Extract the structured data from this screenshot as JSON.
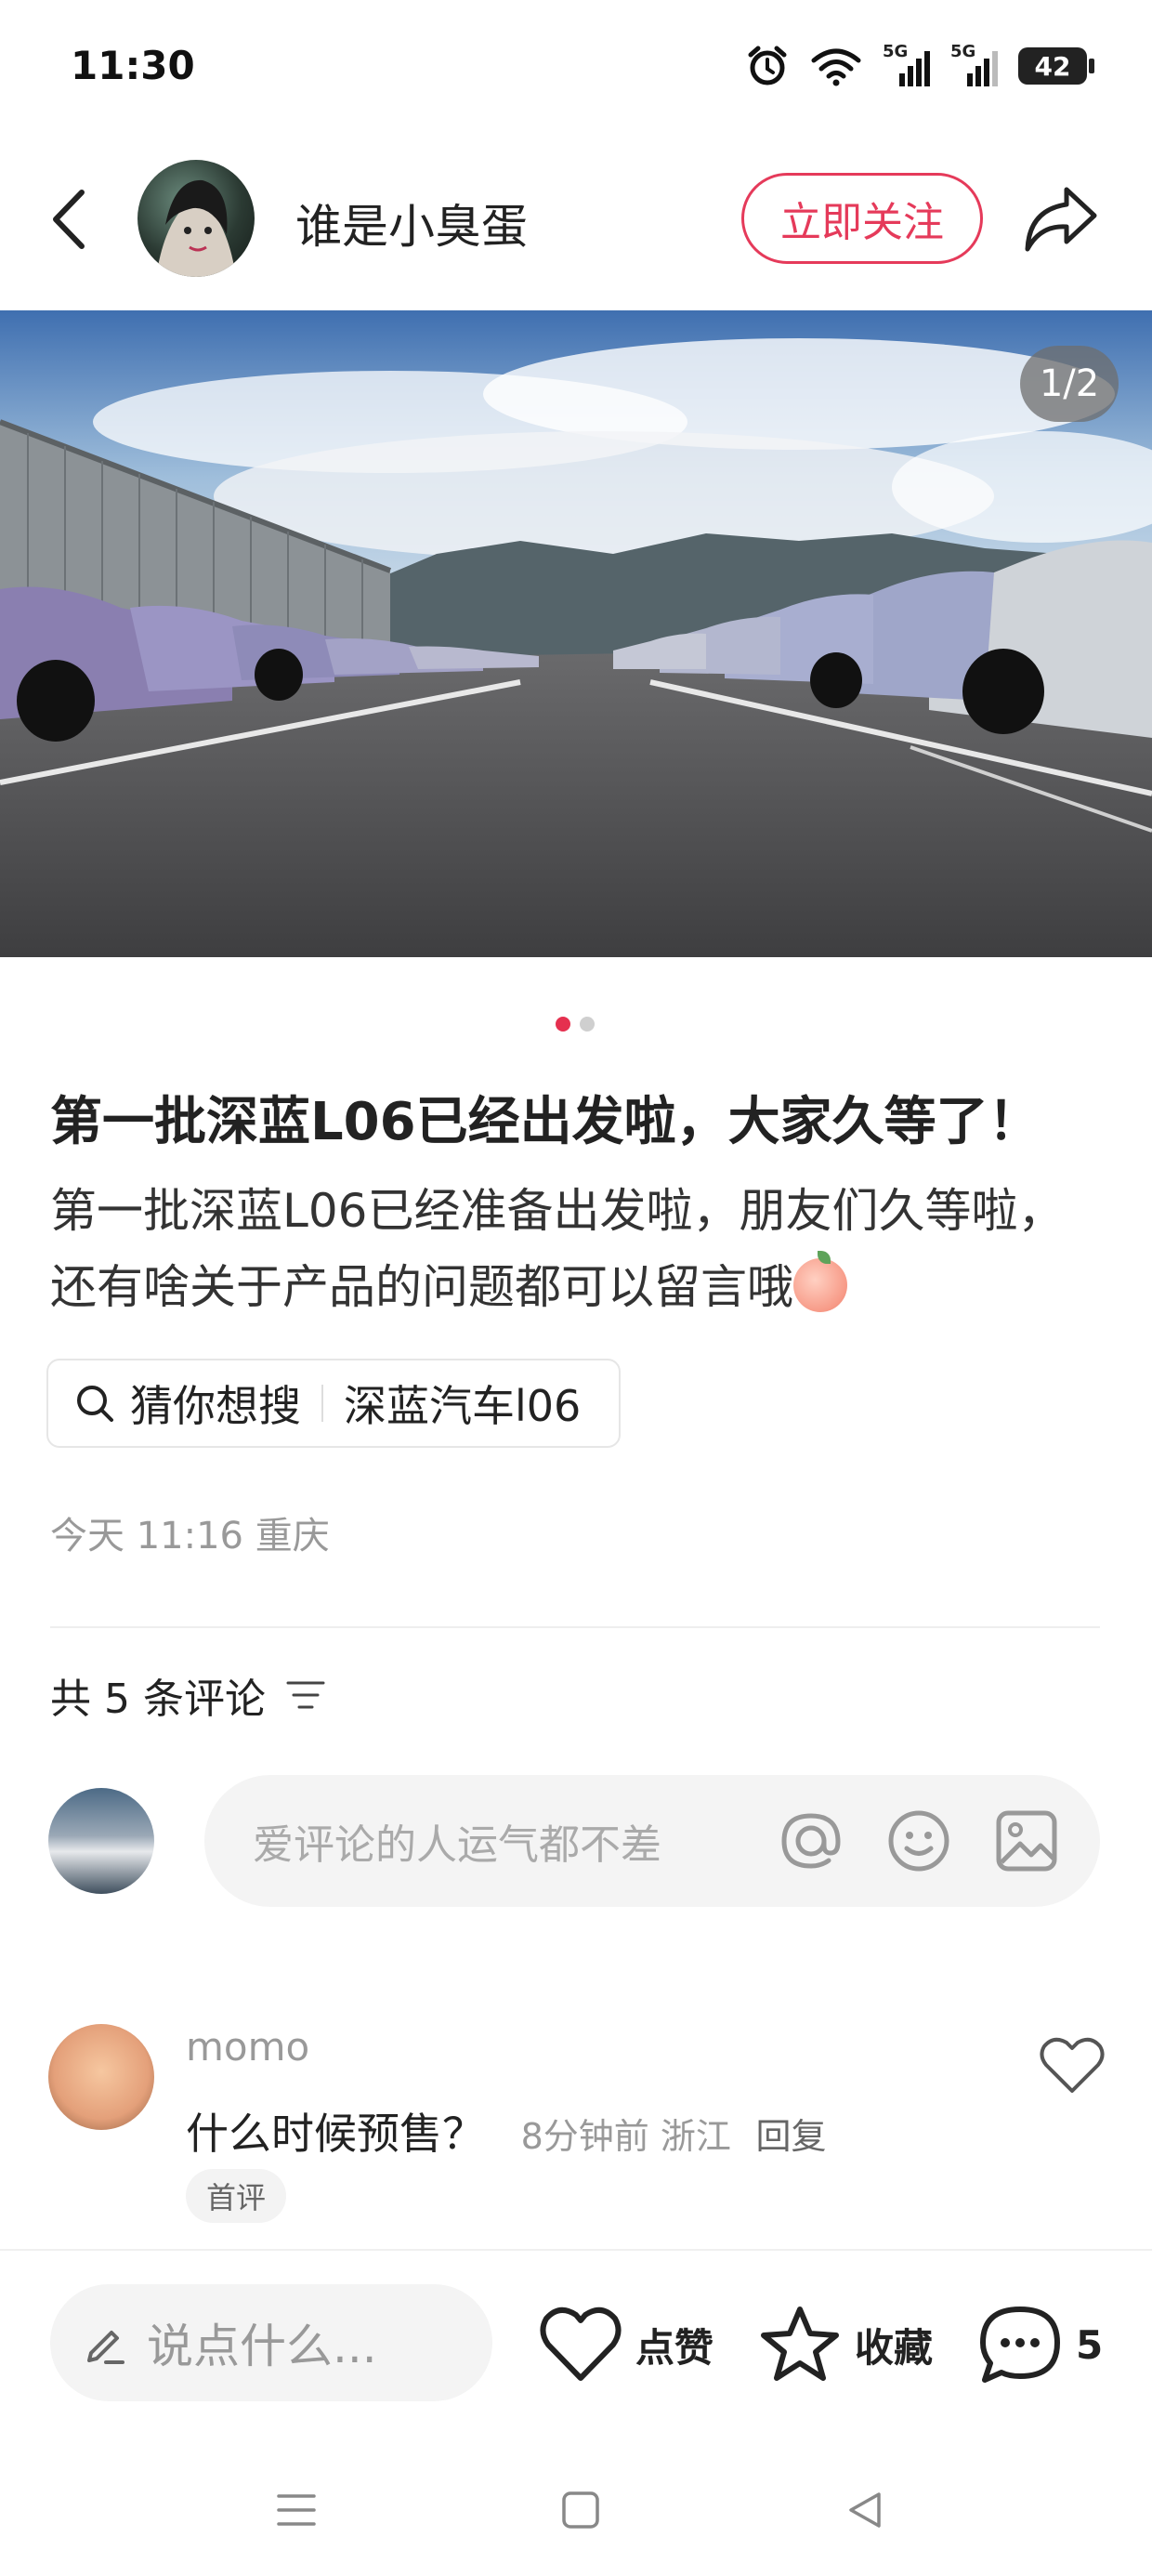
{
  "status_bar": {
    "time": "11:30",
    "network_1": "5G",
    "network_2": "5G",
    "battery": "42"
  },
  "header": {
    "author_name": "谁是小臭蛋",
    "follow_label": "立即关注"
  },
  "hero": {
    "page_counter": "1/2",
    "pages_total": 2,
    "current_page": 1
  },
  "post": {
    "title": "第一批深蓝L06已经出发啦，大家久等了！",
    "body": "第一批深蓝L06已经准备出发啦，朋友们久等啦，还有啥关于产品的问题都可以留言哦",
    "search_chip": {
      "label": "猜你想搜",
      "term": "深蓝汽车l06"
    },
    "meta": "今天 11:16 重庆"
  },
  "comments": {
    "header": "共 5 条评论",
    "input_placeholder": "爱评论的人运气都不差",
    "items": [
      {
        "author": "momo",
        "text": "什么时候预售？",
        "time_location": "8分钟前 浙江",
        "reply_label": "回复",
        "badge": "首评"
      }
    ]
  },
  "bottom_bar": {
    "say_placeholder": "说点什么...",
    "like_label": "点赞",
    "collect_label": "收藏",
    "comment_count": "5"
  },
  "colors": {
    "accent": "#e53a5a",
    "active_dot": "#e5304f"
  }
}
